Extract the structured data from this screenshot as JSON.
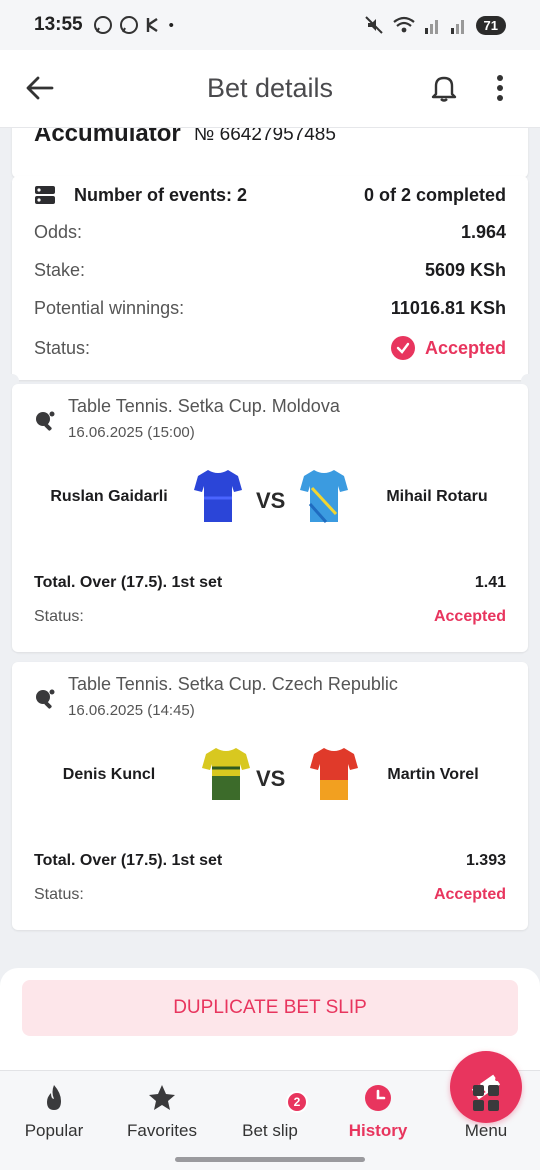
{
  "status_bar": {
    "time": "13:55",
    "dot": "•",
    "battery": "71"
  },
  "header": {
    "title": "Bet details"
  },
  "bet": {
    "type": "Accumulator",
    "number": "№ 66427957485",
    "events_label": "Number of events: 2",
    "completed": "0 of 2 completed",
    "odds_label": "Odds:",
    "odds_value": "1.964",
    "stake_label": "Stake:",
    "stake_value": "5609 KSh",
    "winnings_label": "Potential winnings:",
    "winnings_value": "11016.81 KSh",
    "status_label": "Status:",
    "status_value": "Accepted"
  },
  "events": [
    {
      "league": "Table Tennis. Setka Cup. Moldova",
      "date": "16.06.2025 (15:00)",
      "team1": "Ruslan Gaidarli",
      "team2": "Mihail Rotaru",
      "vs": "VS",
      "market": "Total. Over (17.5). 1st set",
      "odd": "1.41",
      "status_label": "Status:",
      "status": "Accepted"
    },
    {
      "league": "Table Tennis. Setka Cup. Czech Republic",
      "date": "16.06.2025 (14:45)",
      "team1": "Denis Kuncl",
      "team2": "Martin Vorel",
      "vs": "VS",
      "market": "Total. Over (17.5). 1st set",
      "odd": "1.393",
      "status_label": "Status:",
      "status": "Accepted"
    }
  ],
  "actions": {
    "duplicate": "DUPLICATE BET SLIP"
  },
  "nav": {
    "items": [
      {
        "label": "Popular",
        "icon": "flame-icon"
      },
      {
        "label": "Favorites",
        "icon": "star-icon"
      },
      {
        "label": "Bet slip",
        "icon": "ticket-icon"
      },
      {
        "label": "History",
        "icon": "clock-icon"
      },
      {
        "label": "Menu",
        "icon": "grid-icon"
      }
    ],
    "betslip_count": "2",
    "active": "History"
  },
  "colors": {
    "accent": "#e8355e",
    "background": "#eef0f3"
  }
}
